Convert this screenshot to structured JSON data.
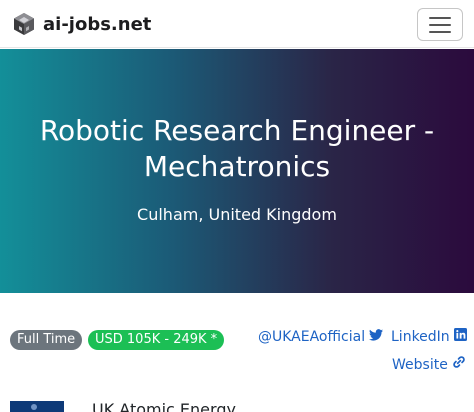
{
  "nav": {
    "brand_text": "ai-jobs.net",
    "brand_icon": "cube-logo-icon",
    "menu_icon": "hamburger-menu-icon"
  },
  "hero": {
    "title": "Robotic Research Engineer - Mechatronics",
    "location": "Culham, United Kingdom",
    "gradient_colors": [
      "#138f99",
      "#2b0a3d"
    ]
  },
  "job": {
    "type_badge": "Full Time",
    "salary_badge": "USD 105K - 249K *",
    "badge_colors": {
      "type": "#6c757d",
      "salary": "#1cbf55"
    }
  },
  "links": {
    "twitter": {
      "label": "@UKAEAofficial",
      "icon": "twitter-icon"
    },
    "linkedin": {
      "label": "LinkedIn",
      "icon": "linkedin-icon"
    },
    "website": {
      "label": "Website",
      "icon": "link-icon"
    },
    "color": "#1e63c4"
  },
  "company": {
    "name": "UK Atomic Energy"
  }
}
